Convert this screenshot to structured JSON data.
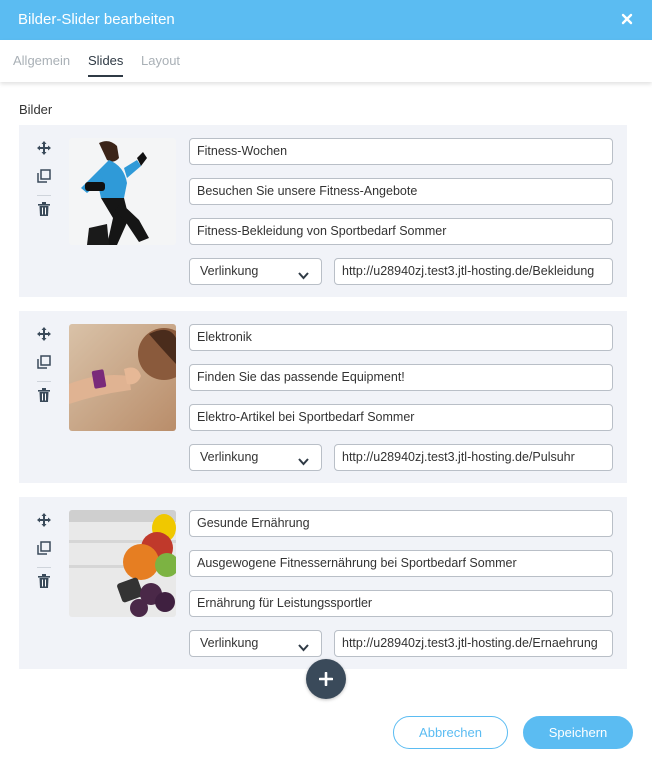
{
  "dialog": {
    "title": "Bilder-Slider bearbeiten",
    "close_icon": "close-icon"
  },
  "tabs": [
    {
      "label": "Allgemein",
      "active": false
    },
    {
      "label": "Slides",
      "active": true
    },
    {
      "label": "Layout",
      "active": false
    }
  ],
  "section_label": "Bilder",
  "slides": [
    {
      "image": "fitness-runner-photo",
      "title": "Fitness-Wochen",
      "subtitle": "Besuchen Sie unsere Fitness-Angebote",
      "description": "Fitness-Bekleidung von Sportbedarf Sommer",
      "link_type": "Verlinkung",
      "url": "http://u28940zj.test3.jtl-hosting.de/Bekleidung"
    },
    {
      "image": "fitness-tracker-photo",
      "title": "Elektronik",
      "subtitle": "Finden Sie das passende Equipment!",
      "description": "Elektro-Artikel bei Sportbedarf Sommer",
      "link_type": "Verlinkung",
      "url": "http://u28940zj.test3.jtl-hosting.de/Pulsuhr"
    },
    {
      "image": "healthy-food-photo",
      "title": "Gesunde Ernährung",
      "subtitle": "Ausgewogene Fitnessernährung bei Sportbedarf Sommer",
      "description": "Ernährung für Leistungssportler",
      "link_type": "Verlinkung",
      "url": "http://u28940zj.test3.jtl-hosting.de/Ernaehrung"
    }
  ],
  "add_icon": "plus-icon",
  "buttons": {
    "cancel": "Abbrechen",
    "save": "Speichern"
  },
  "colors": {
    "accent": "#5bbcf2",
    "panel": "#f1f3f8",
    "add_button": "#3a4a5a"
  }
}
